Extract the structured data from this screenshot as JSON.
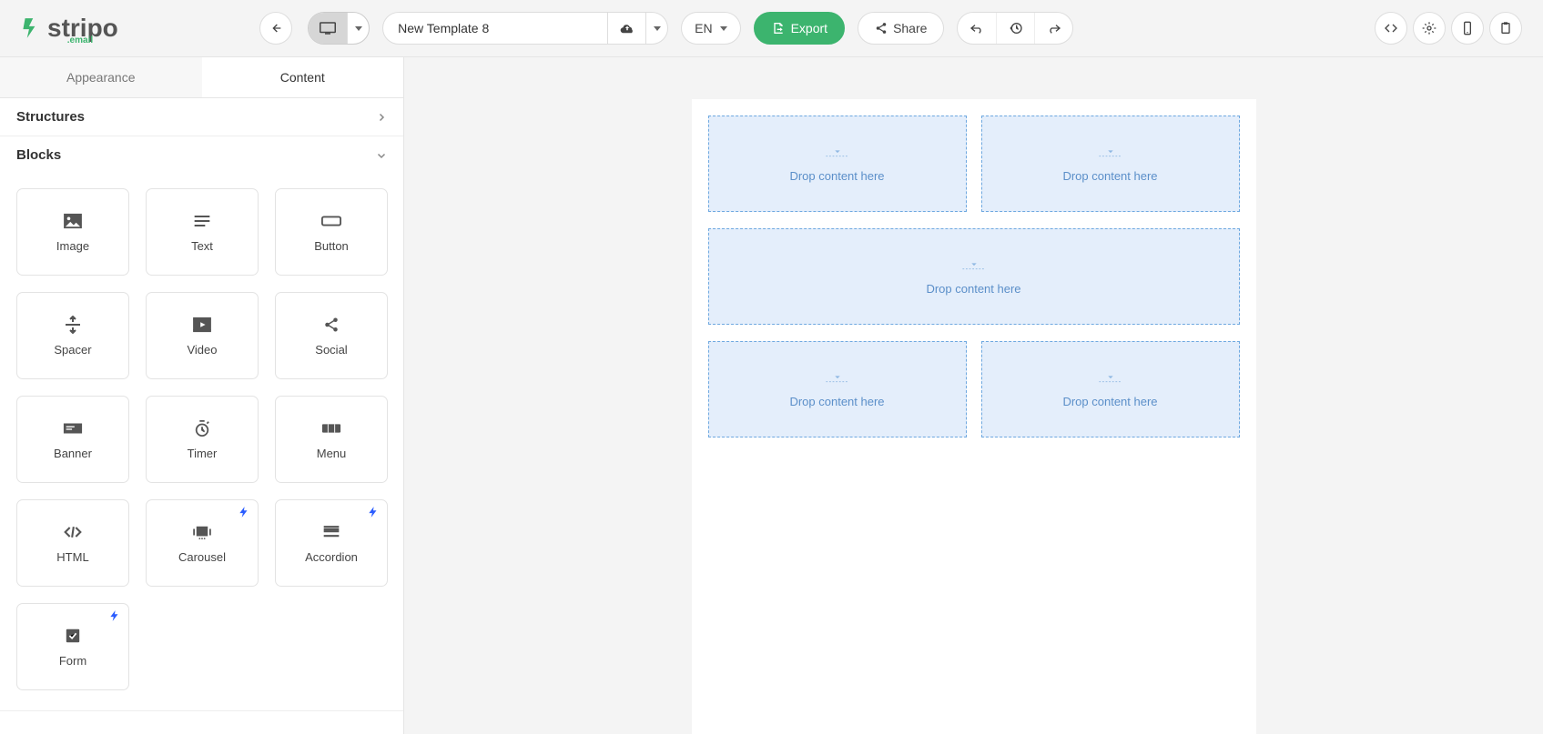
{
  "brand": {
    "name": "stripo",
    "sub": ".email"
  },
  "header": {
    "template_name": "New Template 8",
    "lang": "EN",
    "export_label": "Export",
    "share_label": "Share"
  },
  "sidebar": {
    "tabs": {
      "appearance": "Appearance",
      "content": "Content"
    },
    "sections": {
      "structures": "Structures",
      "blocks": "Blocks"
    },
    "blocks": [
      {
        "label": "Image"
      },
      {
        "label": "Text"
      },
      {
        "label": "Button"
      },
      {
        "label": "Spacer"
      },
      {
        "label": "Video"
      },
      {
        "label": "Social"
      },
      {
        "label": "Banner"
      },
      {
        "label": "Timer"
      },
      {
        "label": "Menu"
      },
      {
        "label": "HTML"
      },
      {
        "label": "Carousel",
        "amp": true
      },
      {
        "label": "Accordion",
        "amp": true
      },
      {
        "label": "Form",
        "amp": true
      }
    ]
  },
  "canvas": {
    "drop_text": "Drop content here"
  }
}
